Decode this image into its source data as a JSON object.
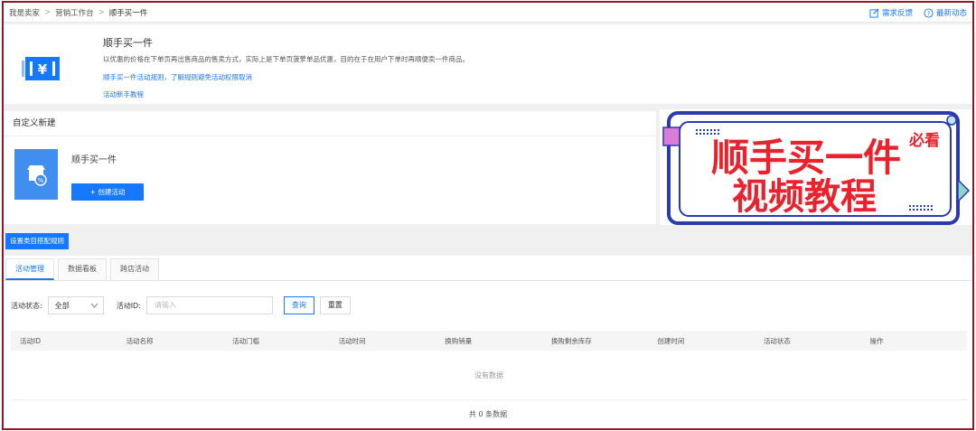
{
  "breadcrumb": {
    "items": [
      "我是卖家",
      "营销工作台",
      "顺手买一件"
    ],
    "separator": ">"
  },
  "toplinks": {
    "feedback": "需求反馈",
    "news": "最新动态"
  },
  "intro": {
    "title": "顺手买一件",
    "description": "以优惠的价格在下单页再出售商品的售卖方式，实际上是下单页菠萝单品优惠，目的在于在用户下单时再顺便卖一件商品。",
    "rules_link": "顺手买一件活动规则，了解规则避免活动权限取消",
    "tutorial_link": "活动新手教程"
  },
  "custom": {
    "header": "自定义新建",
    "card_title": "顺手买一件",
    "create_button": "+ 创建活动"
  },
  "banner": {
    "line1": "顺手买一件",
    "line2": "视频教程",
    "badge": "必看"
  },
  "rules_button": "设置类目搭配规则",
  "tabs": [
    {
      "label": "活动管理",
      "active": true
    },
    {
      "label": "数据看板",
      "active": false
    },
    {
      "label": "跨店活动",
      "active": false
    }
  ],
  "filters": {
    "status_label": "活动状态:",
    "status_value": "全部",
    "id_label": "活动ID:",
    "id_placeholder": "请输入",
    "query_button": "查询",
    "reset_button": "重置"
  },
  "table": {
    "columns": [
      "活动ID",
      "活动名称",
      "活动门槛",
      "活动时间",
      "换购销量",
      "换购剩余库存",
      "创建时间",
      "活动状态",
      "操作"
    ],
    "empty_text": "没有数据",
    "total_text": "共 0 条数据"
  },
  "colors": {
    "primary": "#1677ff",
    "frame": "#8b1a2b",
    "banner_red": "#e8232d"
  }
}
